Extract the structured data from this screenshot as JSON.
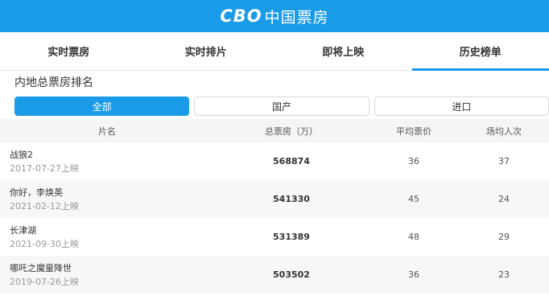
{
  "header": {
    "logo_mark": "CBO",
    "logo_text": "中国票房"
  },
  "tabs": [
    {
      "label": "实时票房"
    },
    {
      "label": "实时排片"
    },
    {
      "label": "即将上映"
    },
    {
      "label": "历史榜单"
    }
  ],
  "active_tab": 3,
  "section_title": "内地总票房排名",
  "filters": [
    {
      "label": "全部"
    },
    {
      "label": "国产"
    },
    {
      "label": "进口"
    }
  ],
  "table": {
    "columns": [
      "片名",
      "总票房（万）",
      "平均票价",
      "场均人次"
    ],
    "rows": [
      {
        "name": "战狼2",
        "date": "2017-07-27上映",
        "gross": "568874",
        "avg_price": "36",
        "avg_people": "37"
      },
      {
        "name": "你好，李焕英",
        "date": "2021-02-12上映",
        "gross": "541330",
        "avg_price": "45",
        "avg_people": "24"
      },
      {
        "name": "长津湖",
        "date": "2021-09-30上映",
        "gross": "531389",
        "avg_price": "48",
        "avg_people": "29"
      },
      {
        "name": "哪吒之魔童降世",
        "date": "2019-07-26上映",
        "gross": "503502",
        "avg_price": "36",
        "avg_people": "23"
      }
    ]
  },
  "colors": {
    "brand": "#1a9be8",
    "row_alt": "#f7f7f7",
    "header_bg": "#f5f5f5"
  }
}
